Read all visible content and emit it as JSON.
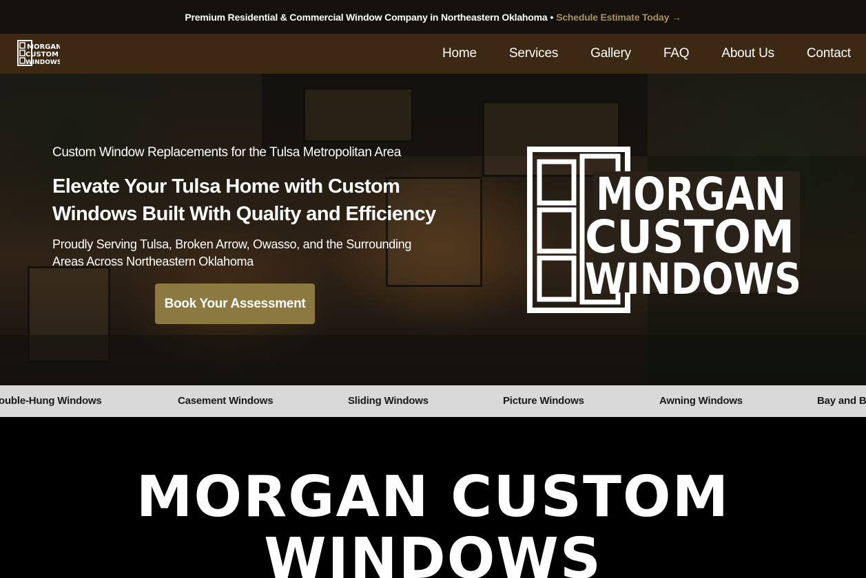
{
  "announcement": {
    "text": "Premium Residential & Commercial Window Company in Northeastern Oklahoma",
    "separator": "•",
    "link_label": "Schedule Estimate Today →",
    "link_color": "#a89257"
  },
  "nav": {
    "logo": "Morgan Custom Windows logo",
    "items": [
      "Home",
      "Services",
      "Gallery",
      "FAQ",
      "About Us",
      "Contact"
    ],
    "background": "#3d2814"
  },
  "hero": {
    "tagline": "Custom Window Replacements for the Tulsa Metropolitan Area",
    "title": "Elevate Your Tulsa Home with Custom Windows Built With Quality and Efficiency",
    "subtitle": "Proudly Serving Tulsa, Broken Arrow, Owasso, and the Surrounding Areas Across Northeastern Oklahoma",
    "cta_label": "Book Your Assessment",
    "cta_color": "#8b7940",
    "logo_lines": [
      "MORGAN",
      "CUSTOM",
      "WINDOWS"
    ]
  },
  "ticker": {
    "items": [
      "ouble-Hung Windows",
      "Casement Windows",
      "Sliding Windows",
      "Picture Windows",
      "Awning Windows",
      "Bay and Bo"
    ]
  },
  "brand_band": {
    "text": "MORGAN CUSTOM WINDOWS"
  }
}
